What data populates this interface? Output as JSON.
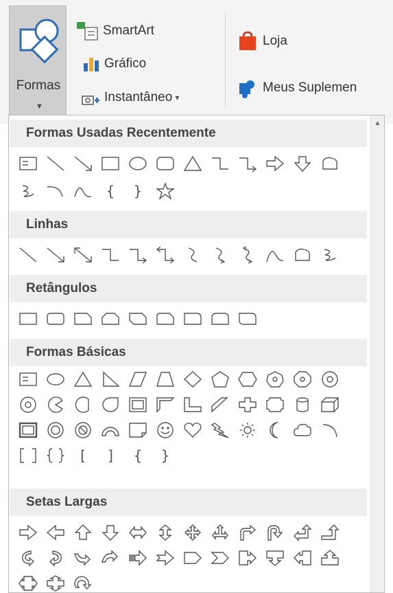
{
  "ribbon": {
    "shapes_button": {
      "label": "Formas",
      "icon": "shapes-icon"
    },
    "smartart": {
      "label": "SmartArt",
      "icon": "smartart-icon"
    },
    "chart": {
      "label": "Gráfico",
      "icon": "chart-icon"
    },
    "screenshot": {
      "label": "Instantâneo",
      "icon": "screenshot-icon",
      "dropdown": "▾"
    },
    "store": {
      "label": "Loja",
      "icon": "store-icon",
      "color": "#e8431f"
    },
    "addins": {
      "label": "Meus Suplemen",
      "icon": "addins-icon",
      "color": "#1f6fc4"
    }
  },
  "gallery": {
    "sections": [
      {
        "title": "Formas Usadas Recentemente"
      },
      {
        "title": "Linhas"
      },
      {
        "title": "Retângulos"
      },
      {
        "title": "Formas Básicas"
      },
      {
        "title": "Setas Largas"
      }
    ],
    "brace_glyphs": {
      "open_curly": "{",
      "close_curly": "}",
      "open_square": "[",
      "close_square": "]"
    }
  }
}
